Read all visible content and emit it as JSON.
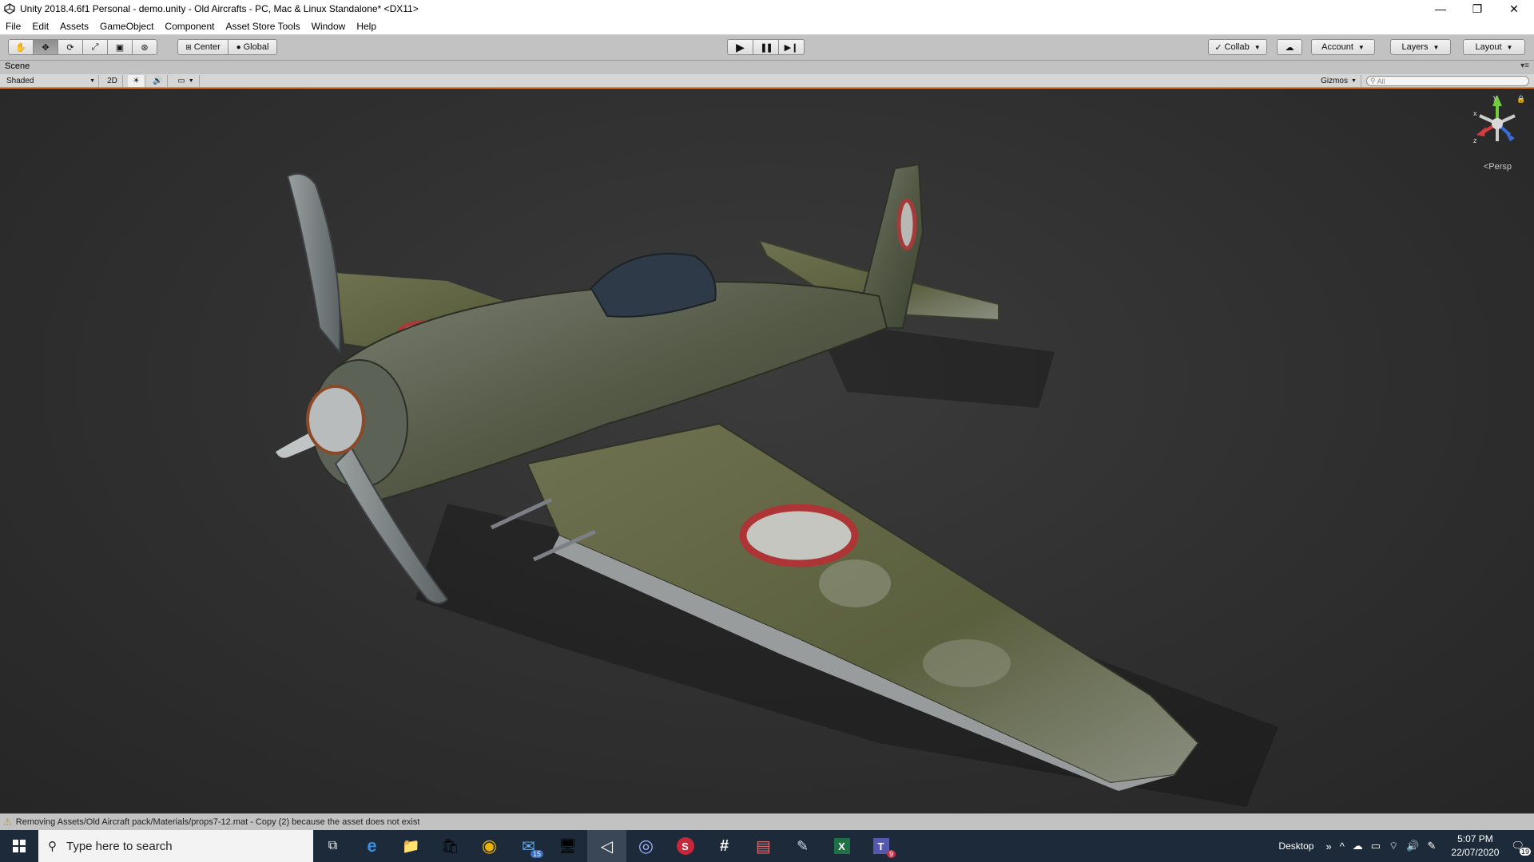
{
  "window": {
    "title": "Unity 2018.4.6f1 Personal - demo.unity - Old Aircrafts - PC, Mac & Linux Standalone* <DX11>",
    "minimize_glyph": "—",
    "restore_glyph": "❐",
    "close_glyph": "✕"
  },
  "menu": {
    "items": [
      "File",
      "Edit",
      "Assets",
      "GameObject",
      "Component",
      "Asset Store Tools",
      "Window",
      "Help"
    ]
  },
  "toolbar": {
    "tools": [
      {
        "name": "hand-tool",
        "glyph": "✋"
      },
      {
        "name": "move-tool",
        "glyph": "✥"
      },
      {
        "name": "rotate-tool",
        "glyph": "⟳"
      },
      {
        "name": "scale-tool",
        "glyph": "⤢"
      },
      {
        "name": "rect-tool",
        "glyph": "▣"
      },
      {
        "name": "transform-tool",
        "glyph": "⊛"
      }
    ],
    "active_tool": "move-tool",
    "pivot_label": "Center",
    "space_label": "Global",
    "play_glyph": "▶",
    "pause_glyph": "❚❚",
    "step_glyph": "▶❙",
    "collab_label": "Collab",
    "cloud_glyph": "☁",
    "account_label": "Account",
    "layers_label": "Layers",
    "layout_label": "Layout"
  },
  "scene": {
    "tab_label": "Scene",
    "shading_mode": "Shaded",
    "mode_2d": "2D",
    "gizmos_label": "Gizmos",
    "search_placeholder": "All",
    "projection_label": "Persp",
    "axis_y": "y",
    "axis_x": "x",
    "axis_z": "z"
  },
  "status": {
    "message": "Removing Assets/Old Aircraft pack/Materials/props7-12.mat - Copy (2) because the asset does not exist"
  },
  "taskbar": {
    "search_placeholder": "Type here to search",
    "apps": [
      {
        "name": "task-view",
        "glyph": "⧉"
      },
      {
        "name": "edge",
        "glyph": "e"
      },
      {
        "name": "file-explorer",
        "glyph": "📁"
      },
      {
        "name": "store",
        "glyph": "🛍"
      },
      {
        "name": "chrome",
        "glyph": "◉"
      },
      {
        "name": "mail",
        "glyph": "✉",
        "badge": "15"
      },
      {
        "name": "remote-desktop",
        "glyph": "🖥"
      },
      {
        "name": "unity",
        "glyph": "◁",
        "active": true
      },
      {
        "name": "cinema4d",
        "glyph": "◎"
      },
      {
        "name": "app-s",
        "glyph": "S"
      },
      {
        "name": "slack",
        "glyph": "#"
      },
      {
        "name": "winrar",
        "glyph": "▤"
      },
      {
        "name": "paint",
        "glyph": "✎"
      },
      {
        "name": "excel",
        "glyph": "X"
      },
      {
        "name": "teams",
        "glyph": "T",
        "badge": "9"
      }
    ],
    "desktop_label": "Desktop",
    "time": "5:07 PM",
    "date": "22/07/2020",
    "notifications": "19"
  },
  "colors": {
    "accent_orange": "#f0822a",
    "viewport_bg": "#2f2f2f",
    "taskbar_bg": "#1c2a3a"
  }
}
